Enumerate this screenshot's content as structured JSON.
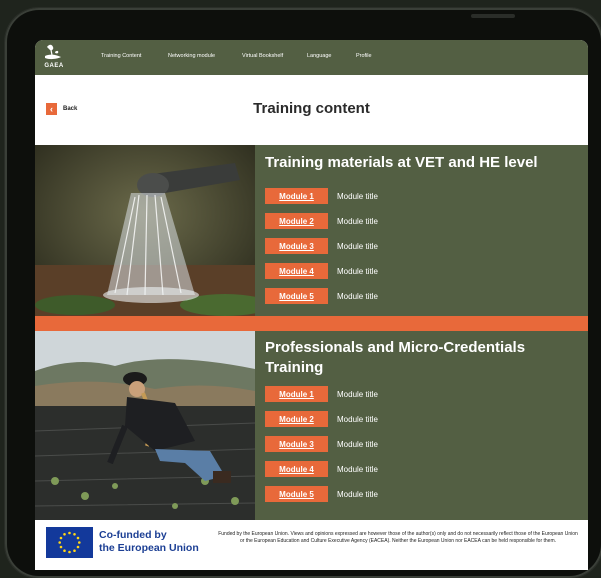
{
  "nav": {
    "logo_text": "GAEA",
    "items": [
      "Training Content",
      "Networking module",
      "Virtual Bookshelf",
      "Language",
      "Profile"
    ]
  },
  "header": {
    "back_label": "Back",
    "back_icon": "‹",
    "title": "Training content"
  },
  "sections": [
    {
      "title": "Training materials at VET and HE level",
      "modules": [
        {
          "label": "Module 1",
          "title": "Module title"
        },
        {
          "label": "Module 2",
          "title": "Module title"
        },
        {
          "label": "Module 3",
          "title": "Module title"
        },
        {
          "label": "Module 4",
          "title": "Module title"
        },
        {
          "label": "Module 5",
          "title": "Module title"
        }
      ]
    },
    {
      "title": "Professionals and Micro-Credentials Training",
      "modules": [
        {
          "label": "Module 1",
          "title": "Module title"
        },
        {
          "label": "Module 2",
          "title": "Module title"
        },
        {
          "label": "Module 3",
          "title": "Module title"
        },
        {
          "label": "Module 4",
          "title": "Module title"
        },
        {
          "label": "Module 5",
          "title": "Module title"
        }
      ]
    }
  ],
  "footer": {
    "cofunded_line1": "Co-funded by",
    "cofunded_line2": "the European Union",
    "disclaimer": "Funded by the European Union. Views and opinions expressed are however those of the author(s) only and do not necessarily reflect those of the European Union or the European Education and Culture Executive Agency (EACEA). Neither the European Union nor EACEA can be held responsible for them."
  },
  "colors": {
    "brand_green": "#535f43",
    "accent_orange": "#e8693a",
    "eu_blue": "#13399b"
  }
}
